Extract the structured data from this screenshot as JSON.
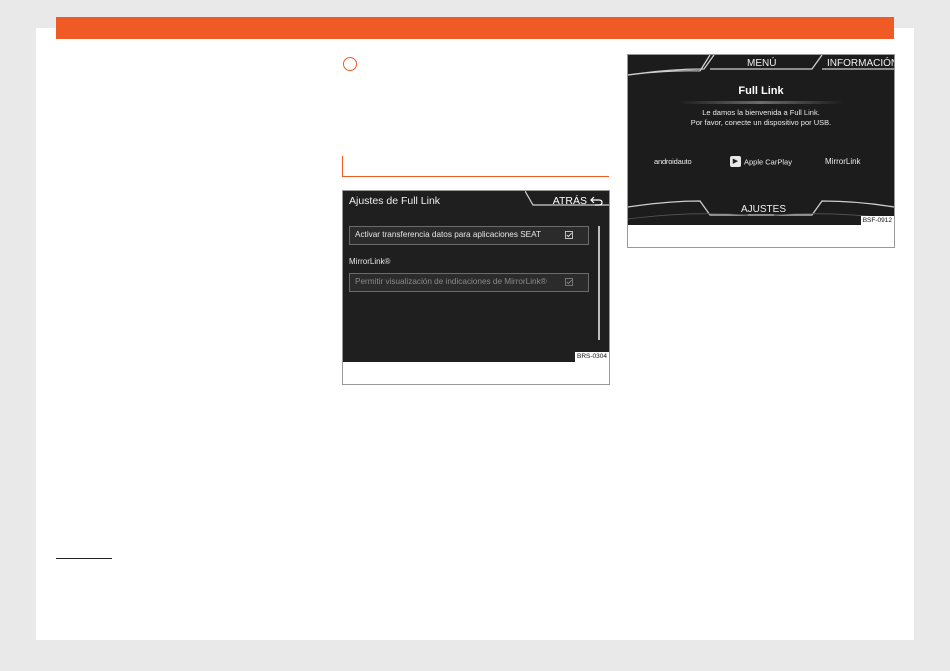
{
  "theme": {
    "accent": "#f05a24",
    "screen_bg": "#1f1f1f"
  },
  "figure_settings": {
    "screen_title": "Ajustes de Full Link",
    "back_label": "ATRÁS",
    "back_icon": "return-arrow-icon",
    "option_1": {
      "label": "Activar transferencia datos para aplicaciones SEAT",
      "checked": true
    },
    "section_label": "MirrorLink®",
    "option_2": {
      "label": "Permitir visualización de indicaciones de MirrorLink®",
      "checked": true,
      "disabled": true
    },
    "figure_code": "BRS-0304"
  },
  "figure_fulllink": {
    "menu_label": "MENÚ",
    "info_label": "INFORMACIÓN",
    "title": "Full Link",
    "welcome_line_1": "Le damos la bienvenida a Full Link.",
    "welcome_line_2": "Por favor, conecte un dispositivo por USB.",
    "brand_android": "androidauto",
    "brand_carplay": "Apple CarPlay",
    "brand_mirrorlink": "MirrorLink",
    "settings_label": "AJUSTES",
    "figure_code": "BSF-0912"
  }
}
